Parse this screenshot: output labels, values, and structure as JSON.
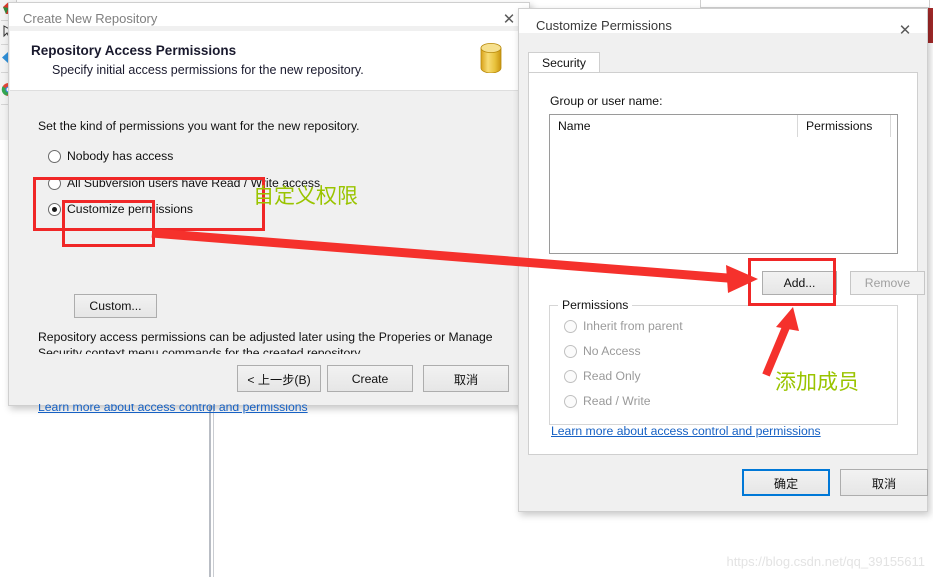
{
  "background": {
    "watermark": "https://blog.csdn.net/qq_39155611"
  },
  "left_strip": {
    "icons": [
      "colored-logo-icon",
      "cursor-icon",
      "blue-back-arrow-icon",
      "chrome-icon"
    ]
  },
  "behind_window": {
    "maximize_label": "❐",
    "close_label": "✕"
  },
  "wizard": {
    "title": "Create New Repository",
    "close_label": "✕",
    "header_title": "Repository Access Permissions",
    "header_subtitle": "Specify initial access permissions for the new repository.",
    "icon": "repository-database-icon",
    "lead": "Set the kind of permissions you want for the new repository.",
    "options": [
      {
        "label": "Nobody has access",
        "checked": false
      },
      {
        "label": "All Subversion users have Read / Write access",
        "checked": false
      },
      {
        "label": "Customize permissions",
        "checked": true
      }
    ],
    "custom_button": "Custom...",
    "note_line1": "Repository access permissions can be adjusted later using the Properies or Manage Security",
    "note_line2": "context menu commands for the created repository.",
    "learn_more": "Learn more about access control and permissions",
    "footer": {
      "back": "< 上一步(B)",
      "create": "Create",
      "cancel": "取消"
    }
  },
  "permissions_dialog": {
    "title": "Customize Permissions",
    "close_label": "✕",
    "tab": "Security",
    "group_label": "Group or user name:",
    "list": {
      "columns": [
        "Name",
        "Permissions"
      ],
      "rows": []
    },
    "add_button": "Add...",
    "remove_button": "Remove",
    "permissions_group": {
      "title": "Permissions",
      "options": [
        {
          "label": "Inherit from parent",
          "checked": false,
          "disabled": true
        },
        {
          "label": "No Access",
          "checked": false,
          "disabled": true
        },
        {
          "label": "Read Only",
          "checked": false,
          "disabled": true
        },
        {
          "label": "Read / Write",
          "checked": false,
          "disabled": true
        }
      ]
    },
    "learn_more": "Learn more about access control and permissions",
    "footer": {
      "ok": "确定",
      "cancel": "取消"
    }
  },
  "annotations": {
    "custom_permissions_cn": "自定义权限",
    "add_member_cn": "添加成员",
    "highlight_color": "#f02727",
    "text_color": "#9ac400"
  }
}
